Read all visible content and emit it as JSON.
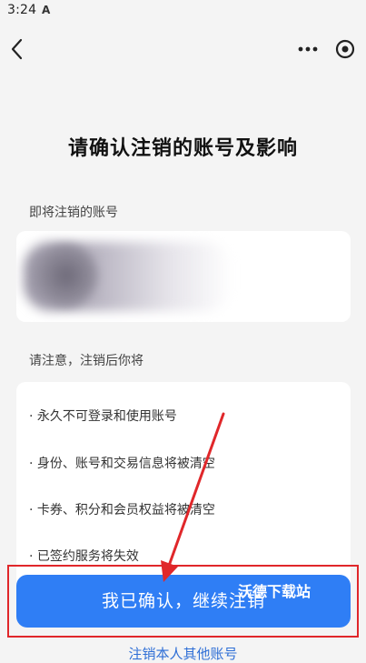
{
  "status_bar": {
    "time": "3:24",
    "app_icon": "A"
  },
  "nav": {
    "back_icon": "chevron-left-icon",
    "more_icon": "more-dots-icon",
    "target_icon": "target-icon"
  },
  "title": "请确认注销的账号及影响",
  "account_section": {
    "label": "即将注销的账号"
  },
  "notice_section": {
    "label": "请注意，注销后你将",
    "items": [
      "· 永久不可登录和使用账号",
      "· 身份、账号和交易信息将被清空",
      "· 卡券、积分和会员权益将被清空",
      "· 已签约服务将失效"
    ]
  },
  "confirm_button": {
    "label": "我已确认，继续注销"
  },
  "watermark": "沃德下载站",
  "other_account_link": "注销本人其他账号",
  "colors": {
    "primary": "#2f7ef5",
    "annotation_red": "#e0272a"
  }
}
